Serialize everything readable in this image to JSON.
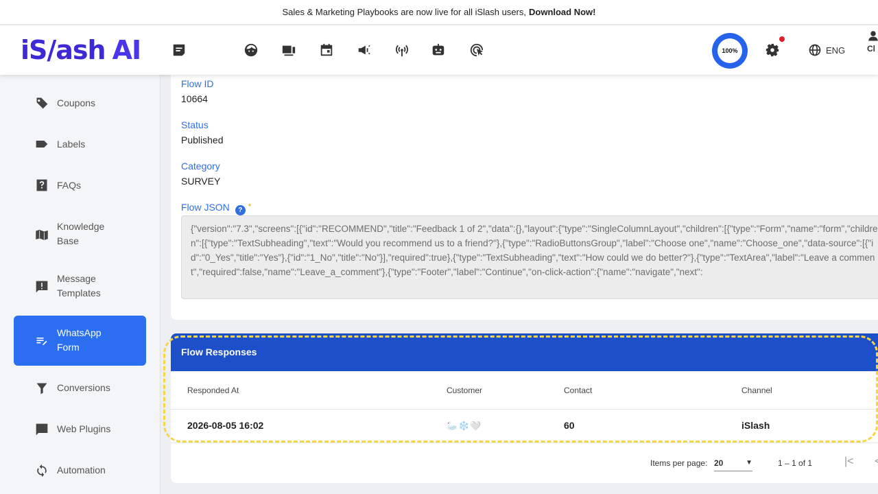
{
  "banner": {
    "text": "Sales & Marketing Playbooks are now live for all iSlash users,",
    "link": "Download Now!"
  },
  "header": {
    "logo_text": "iS/ash",
    "logo_ai": "AI",
    "progress": "100%",
    "language": "ENG",
    "user_label": "Cl"
  },
  "sidebar": {
    "items": [
      {
        "label": "Coupons",
        "icon": "tag-icon"
      },
      {
        "label": "Labels",
        "icon": "label-icon"
      },
      {
        "label": "FAQs",
        "icon": "help-icon"
      },
      {
        "label": "Knowledge\nBase",
        "icon": "book-icon"
      },
      {
        "label": "Message\nTemplates",
        "icon": "alert-message-icon"
      },
      {
        "label": "WhatsApp\nForm",
        "icon": "form-icon",
        "active": true
      },
      {
        "label": "Conversions",
        "icon": "filter-icon"
      },
      {
        "label": "Web Plugins",
        "icon": "chat-icon"
      },
      {
        "label": "Automation",
        "icon": "sync-icon"
      }
    ]
  },
  "details": {
    "flow_id_label": "Flow ID",
    "flow_id": "10664",
    "status_label": "Status",
    "status": "Published",
    "category_label": "Category",
    "category": "SURVEY",
    "json_label": "Flow JSON",
    "json_help": "?",
    "json_required": "*",
    "json_text": "{\"version\":\"7.3\",\"screens\":[{\"id\":\"RECOMMEND\",\"title\":\"Feedback 1 of 2\",\"data\":{},\"layout\":{\"type\":\"SingleColumnLayout\",\"children\":[{\"type\":\"Form\",\"name\":\"form\",\"children\":[{\"type\":\"TextSubheading\",\"text\":\"Would you recommend us to a friend?\"},{\"type\":\"RadioButtonsGroup\",\"label\":\"Choose one\",\"name\":\"Choose_one\",\"data-source\":[{\"id\":\"0_Yes\",\"title\":\"Yes\"},{\"id\":\"1_No\",\"title\":\"No\"}],\"required\":true},{\"type\":\"TextSubheading\",\"text\":\"How could we do better?\"},{\"type\":\"TextArea\",\"label\":\"Leave a comment\",\"required\":false,\"name\":\"Leave_a_comment\"},{\"type\":\"Footer\",\"label\":\"Continue\",\"on-click-action\":{\"name\":\"navigate\",\"next\":"
  },
  "responses": {
    "title": "Flow Responses",
    "columns": [
      "Responded At",
      "Customer",
      "Contact",
      "Channel"
    ],
    "rows": [
      {
        "responded_at": "2026-08-05 16:02",
        "customer": "🦢❄️🤍",
        "contact": "60",
        "channel": "iSlash"
      }
    ],
    "items_per_page_label": "Items per page:",
    "items_per_page": "20",
    "range": "1 – 1 of 1"
  }
}
